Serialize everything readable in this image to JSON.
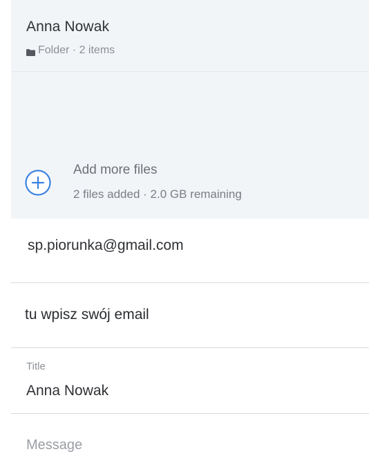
{
  "upload": {
    "folder": {
      "name": "Anna Nowak",
      "icon": "folder-icon",
      "meta": "Folder · 2 items"
    },
    "add_files": {
      "icon": "plus-circle-icon",
      "label": "Add more files",
      "status": "2 files added · 2.0 GB remaining"
    }
  },
  "form": {
    "recipient_value": "sp.piorunka@gmail.com",
    "sender_value": "tu wpisz swój email",
    "title_label": "Title",
    "title_value": "Anna Nowak",
    "message_placeholder": "Message"
  },
  "colors": {
    "panel_bg": "#f2f5f8",
    "accent": "#3b82e0"
  }
}
